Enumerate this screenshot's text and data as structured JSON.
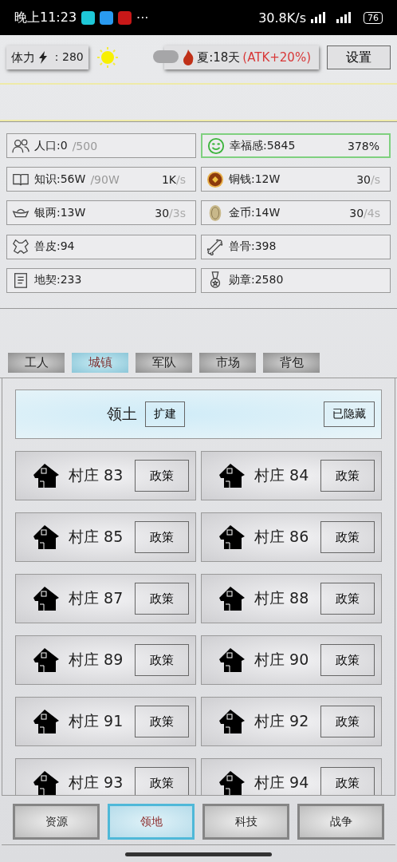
{
  "status_bar": {
    "time": "晚上11:23",
    "more": "···",
    "speed": "30.8K/s",
    "battery": "76"
  },
  "top_bar": {
    "stamina_label": "体力",
    "stamina_value": "：280",
    "season": "夏:18天 ",
    "season_bonus": "(ATK+20%)",
    "settings": "设置"
  },
  "resources": [
    {
      "label": "人口:0",
      "sub": "/500",
      "selected": false
    },
    {
      "label": "幸福感:5845",
      "rate": "378%",
      "selected": true
    },
    {
      "label": "知识:56W",
      "sub": "/90W",
      "rate": "1K",
      "rate_unit": "/s",
      "selected": false
    },
    {
      "label": "铜钱:12W",
      "rate": "30",
      "rate_unit": "/s",
      "selected": false
    },
    {
      "label": "银两:13W",
      "rate": "30",
      "rate_unit": "/3s",
      "selected": false
    },
    {
      "label": "金币:14W",
      "rate": "30",
      "rate_unit": "/4s",
      "selected": false
    },
    {
      "label": "兽皮:94",
      "selected": false
    },
    {
      "label": "兽骨:398",
      "selected": false
    },
    {
      "label": "地契:233",
      "selected": false
    },
    {
      "label": "勋章:2580",
      "selected": false
    }
  ],
  "tabs": [
    {
      "label": "工人",
      "selected": false
    },
    {
      "label": "城镇",
      "selected": true
    },
    {
      "label": "军队",
      "selected": false
    },
    {
      "label": "市场",
      "selected": false
    },
    {
      "label": "背包",
      "selected": false
    }
  ],
  "territory": {
    "title": "领土",
    "expand": "扩建",
    "hidden": "已隐藏"
  },
  "villages": [
    {
      "name": "村庄 83",
      "action": "政策"
    },
    {
      "name": "村庄 84",
      "action": "政策"
    },
    {
      "name": "村庄 85",
      "action": "政策"
    },
    {
      "name": "村庄 86",
      "action": "政策"
    },
    {
      "name": "村庄 87",
      "action": "政策"
    },
    {
      "name": "村庄 88",
      "action": "政策"
    },
    {
      "name": "村庄 89",
      "action": "政策"
    },
    {
      "name": "村庄 90",
      "action": "政策"
    },
    {
      "name": "村庄 91",
      "action": "政策"
    },
    {
      "name": "村庄 92",
      "action": "政策"
    },
    {
      "name": "村庄 93",
      "action": "政策"
    },
    {
      "name": "村庄 94",
      "action": "政策"
    }
  ],
  "bottom_nav": [
    {
      "label": "资源",
      "selected": false
    },
    {
      "label": "领地",
      "selected": true
    },
    {
      "label": "科技",
      "selected": false
    },
    {
      "label": "战争",
      "selected": false
    }
  ]
}
